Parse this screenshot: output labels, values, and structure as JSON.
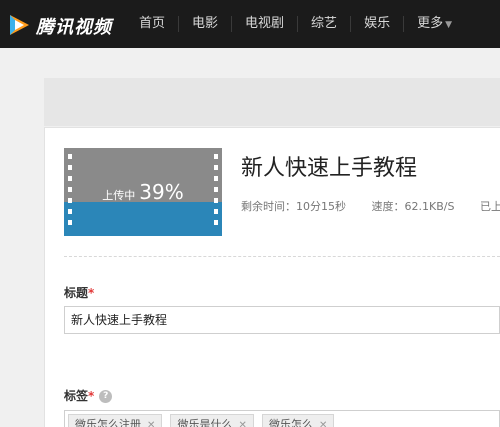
{
  "header": {
    "logo_text": "腾讯视频",
    "nav": [
      "首页",
      "电影",
      "电视剧",
      "综艺",
      "娱乐",
      "更多"
    ]
  },
  "upload": {
    "status": "上传中",
    "progress_text": "39%",
    "progress": 0.39,
    "video_title": "新人快速上手教程",
    "time_remaining": "剩余时间：10分15秒",
    "speed": "速度：62.1KB/S",
    "uploaded": "已上"
  },
  "form": {
    "title_label": "标题",
    "title_value": "新人快速上手教程",
    "tags_label": "标签",
    "required_mark": "*",
    "help_glyph": "?",
    "tags": [
      "微乐怎么注册",
      "微乐是什么",
      "微乐怎么"
    ]
  },
  "colors": {
    "nav_bg": "#1b1b1b",
    "thumb_blue": "#2b86b8",
    "required_red": "#e23a3a"
  }
}
